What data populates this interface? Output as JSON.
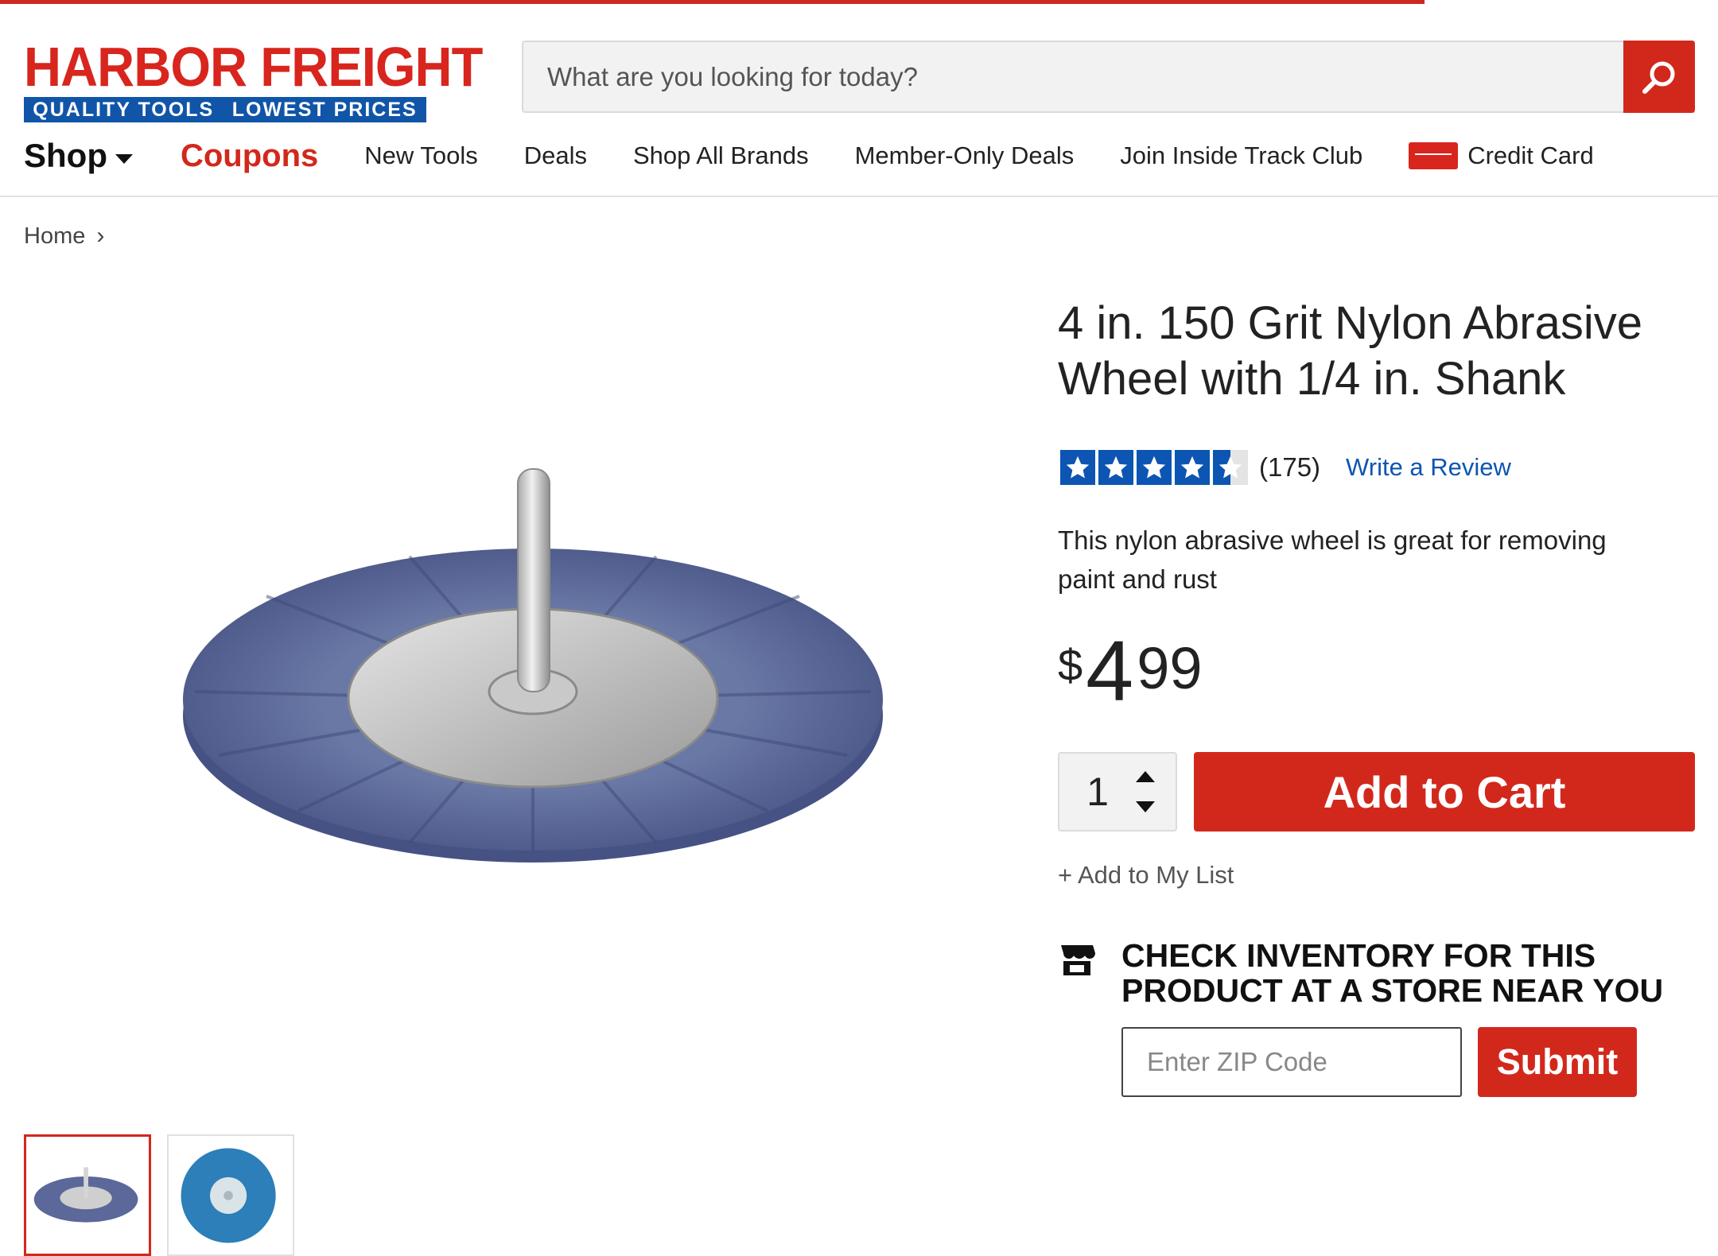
{
  "brand": {
    "name": "HARBOR FREIGHT",
    "tagline_left": "QUALITY TOOLS",
    "tagline_right": "LOWEST PRICES",
    "primary_color": "#d2281c",
    "secondary_color": "#1055a8"
  },
  "search": {
    "placeholder": "What are you looking for today?",
    "icon": "search-icon"
  },
  "nav": {
    "shop": "Shop",
    "coupons": "Coupons",
    "items": [
      "New Tools",
      "Deals",
      "Shop All Brands",
      "Member-Only Deals",
      "Join Inside Track Club"
    ],
    "credit_card": "Credit Card"
  },
  "breadcrumb": {
    "home": "Home",
    "separator": "›"
  },
  "product": {
    "title": "4 in. 150 Grit Nylon Abrasive Wheel with 1/4 in. Shank",
    "rating": 4.5,
    "rating_max": 5,
    "review_count": "(175)",
    "write_review": "Write a Review",
    "description": "This nylon abrasive wheel is great for removing paint and rust",
    "price": {
      "currency": "$",
      "whole": "4",
      "cents": "99"
    },
    "quantity": "1",
    "add_to_cart": "Add to Cart",
    "add_to_list": "+ Add to My List",
    "thumbnails": [
      "product-thumbnail-1",
      "product-thumbnail-2"
    ]
  },
  "inventory": {
    "title": "CHECK INVENTORY FOR THIS PRODUCT AT A STORE NEAR YOU",
    "zip_placeholder": "Enter ZIP Code",
    "submit": "Submit",
    "icon": "store-icon"
  }
}
